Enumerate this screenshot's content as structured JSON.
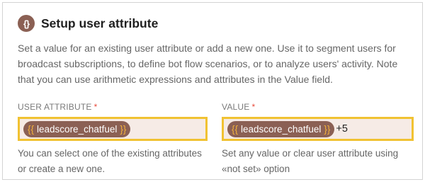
{
  "header": {
    "icon": "curly-braces-icon",
    "icon_glyph": "{}",
    "title": "Setup user attribute"
  },
  "description": "Set a value for an existing user attribute or add a new one. Use it to segment users for broadcast subscriptions, to define bot flow scenarios, or to analyze users' activity. Note that you can use arithmetic expressions and attributes in the Value field.",
  "user_attribute": {
    "label": "USER ATTRIBUTE",
    "required_mark": "*",
    "brace_open": "{{",
    "brace_close": "}}",
    "value": "leadscore_chatfuel",
    "helper": "You can select one of the existing attributes or create a new one."
  },
  "value_field": {
    "label": "VALUE",
    "required_mark": "*",
    "brace_open": "{{",
    "brace_close": "}}",
    "value": "leadscore_chatfuel",
    "suffix": "+5",
    "helper": "Set any value or clear user attribute using «not set» option"
  },
  "colors": {
    "accent_highlight": "#f1c232",
    "pill": "#8b6054",
    "brace": "#f3b13c",
    "required": "#e84b3c",
    "field_bg": "#f6ebe6"
  }
}
